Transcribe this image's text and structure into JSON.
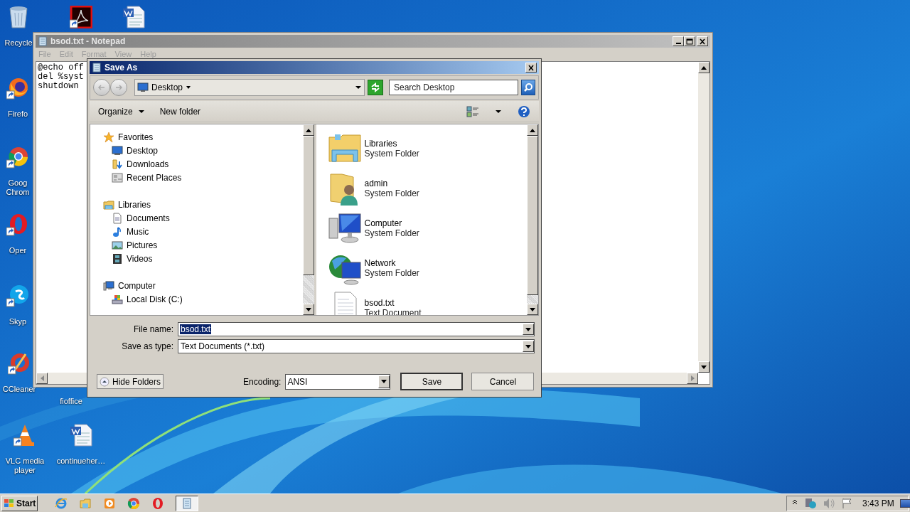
{
  "desktop_icons": [
    {
      "kind": "recycle",
      "label": "Recycle"
    },
    {
      "kind": "acrobat"
    },
    {
      "kind": "word"
    },
    {
      "kind": "firefox",
      "label": "Firefo"
    },
    {
      "kind": "chrome",
      "label": "Goog Chrom"
    },
    {
      "kind": "opera",
      "label": "Oper"
    },
    {
      "kind": "skype",
      "label": "Skyp"
    },
    {
      "kind": "ccleaner",
      "label": "CCleaner"
    },
    {
      "kind": "none",
      "label": "fioffice"
    },
    {
      "kind": "vlc",
      "label": "VLC media player"
    },
    {
      "kind": "word",
      "label": "continueher…"
    }
  ],
  "notepad": {
    "title": "bsod.txt - Notepad",
    "menu": [
      "File",
      "Edit",
      "Format",
      "View",
      "Help"
    ],
    "lines": [
      "@echo off",
      "del %syst",
      "shutdown"
    ]
  },
  "save_as": {
    "title": "Save As",
    "address": "Desktop",
    "search": {
      "placeholder": "Search Desktop"
    },
    "toolbar": [
      "Organize",
      "New folder"
    ],
    "nav": [
      {
        "label": "Favorites",
        "kind": "favorites",
        "children": [
          {
            "label": "Desktop",
            "kind": "desktop"
          },
          {
            "label": "Downloads",
            "kind": "downloads"
          },
          {
            "label": "Recent Places",
            "kind": "recent"
          }
        ]
      },
      {
        "label": "Libraries",
        "kind": "libraries",
        "children": [
          {
            "label": "Documents",
            "kind": "documents"
          },
          {
            "label": "Music",
            "kind": "music"
          },
          {
            "label": "Pictures",
            "kind": "pictures"
          },
          {
            "label": "Videos",
            "kind": "videos"
          }
        ]
      },
      {
        "label": "Computer",
        "kind": "computer",
        "children": [
          {
            "label": "Local Disk (C:)",
            "kind": "disk"
          }
        ]
      }
    ],
    "items": [
      {
        "name": "Libraries",
        "type": "System Folder",
        "kind": "library"
      },
      {
        "name": "admin",
        "type": "System Folder",
        "kind": "user"
      },
      {
        "name": "Computer",
        "type": "System Folder",
        "kind": "computer"
      },
      {
        "name": "Network",
        "type": "System Folder",
        "kind": "network"
      },
      {
        "name": "bsod.txt",
        "type": "Text Document",
        "kind": "text"
      }
    ],
    "file_name_label": "File name:",
    "file_name": "bsod.txt",
    "type_label": "Save as type:",
    "save_type": "Text Documents (*.txt)",
    "hide_folders": "Hide Folders",
    "encoding_label": "Encoding:",
    "encoding": "ANSI",
    "buttons": [
      "Save",
      "Cancel"
    ]
  },
  "taskbar": {
    "start": "Start",
    "clock": "3:43 PM"
  }
}
